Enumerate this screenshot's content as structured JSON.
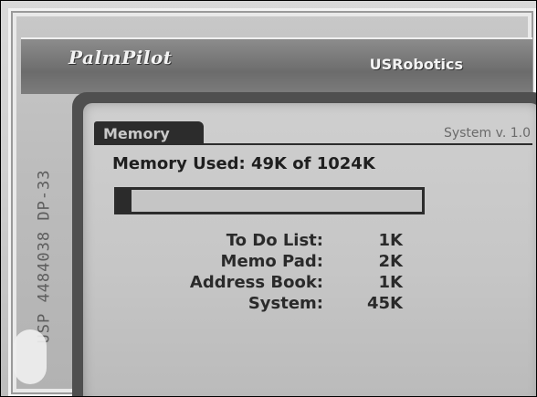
{
  "device": {
    "brand_left": "PalmPilot",
    "brand_right": "USRobotics",
    "side_text": "USP 4484038  DP-33"
  },
  "app": {
    "title": "Memory",
    "system_version": "System v. 1.0",
    "memory_used_text": "Memory Used: 49K of 1024K",
    "used_fraction": 0.0479
  },
  "breakdown": [
    {
      "label": "To Do List:",
      "value": "1K"
    },
    {
      "label": "Memo Pad:",
      "value": "2K"
    },
    {
      "label": "Address Book:",
      "value": "1K"
    },
    {
      "label": "System:",
      "value": "45K"
    }
  ],
  "colors": {
    "lcd_background": "#c6c6c6",
    "lcd_ink": "#2a2a2a"
  }
}
